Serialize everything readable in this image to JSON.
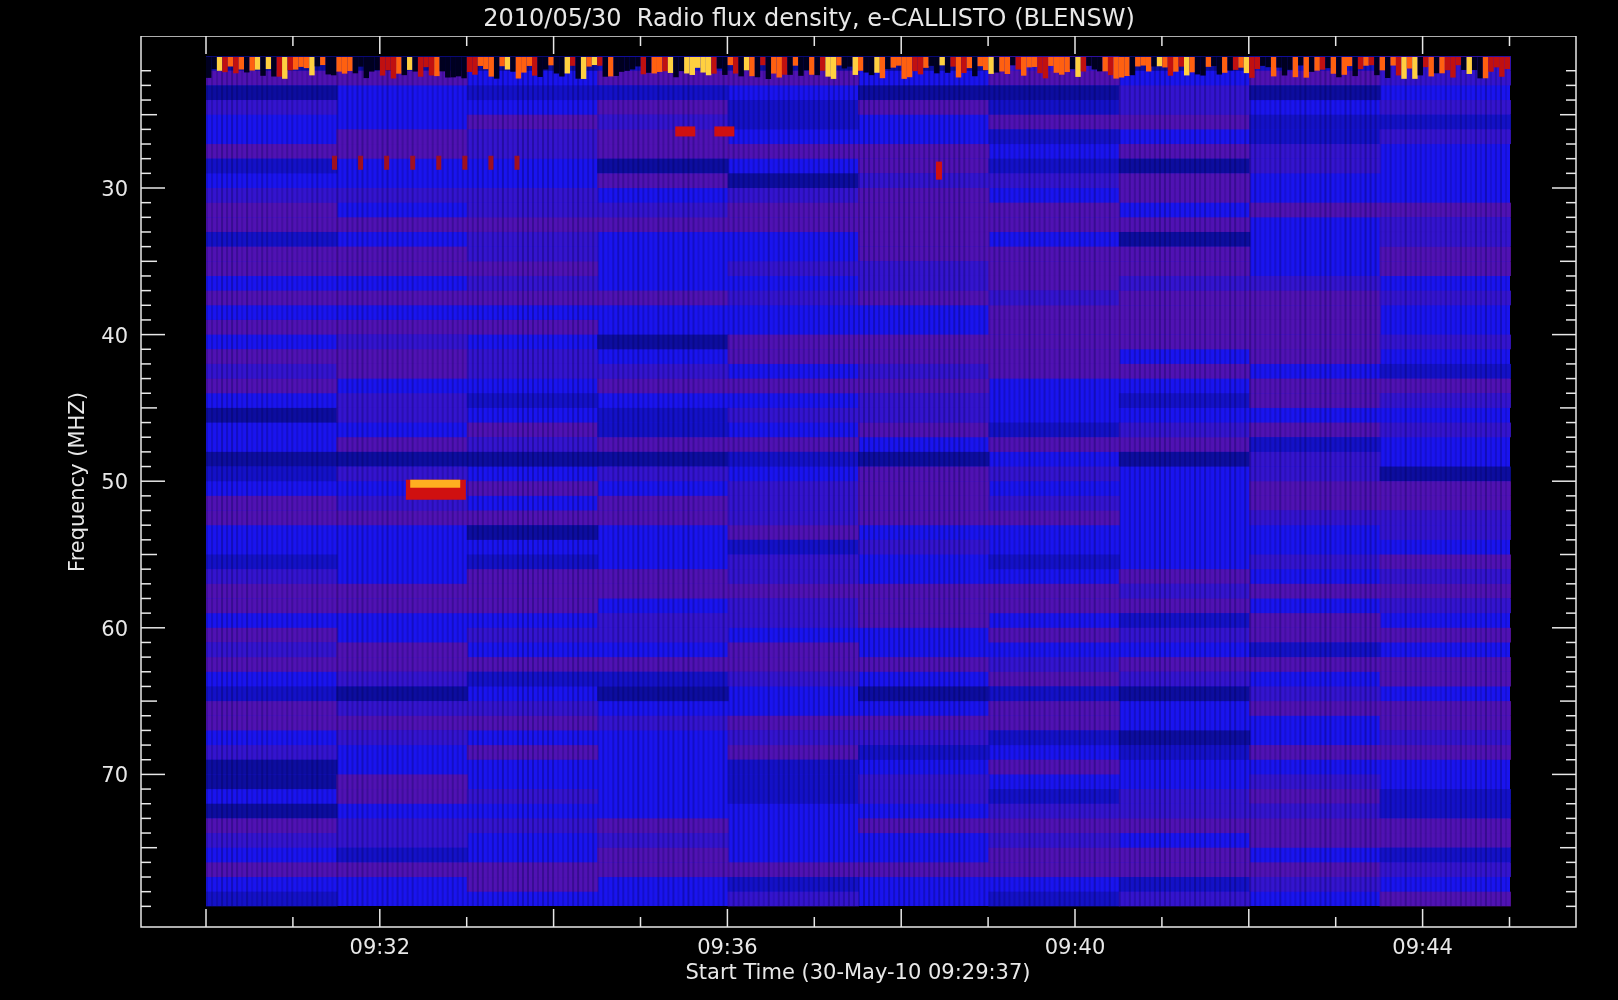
{
  "title": "2010/05/30  Radio flux density, e-CALLISTO (BLENSW)",
  "y_axis": {
    "label": "Frequency (MHZ)",
    "ticks": [
      "30",
      "40",
      "50",
      "60",
      "70"
    ]
  },
  "x_axis": {
    "label": "Start Time (30-May-10 09:29:37)",
    "ticks": [
      "09:32",
      "09:36",
      "09:40",
      "09:44"
    ]
  }
}
